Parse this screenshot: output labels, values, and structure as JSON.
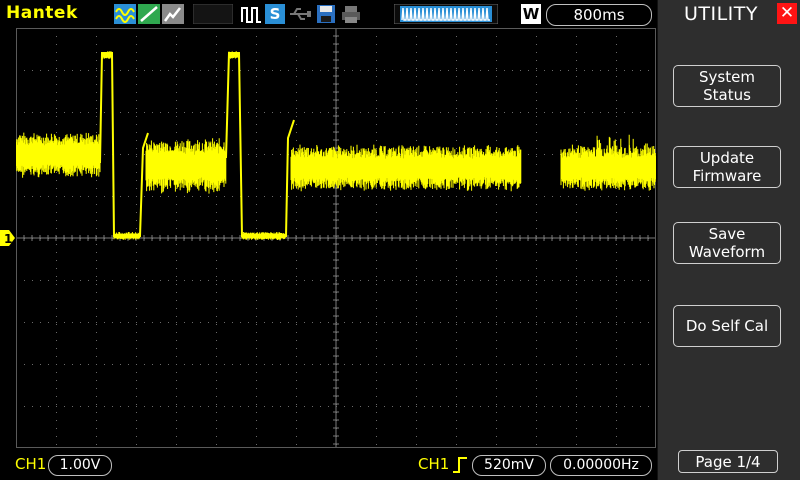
{
  "brand": "Hantek",
  "timebase": "800ms",
  "top_mode_letter": "S",
  "window_letter": "W",
  "menu": {
    "title": "UTILITY",
    "buttons": [
      {
        "label": "System\nStatus"
      },
      {
        "label": "Update\nFirmware"
      },
      {
        "label": "Save\nWaveform"
      },
      {
        "label": "Do Self Cal"
      }
    ],
    "page": "Page 1/4"
  },
  "channel": {
    "name": "CH1",
    "volts_div": "1.00V",
    "marker": "1"
  },
  "trigger": {
    "source": "CH1",
    "edge": "rising",
    "level": "520mV",
    "frequency": "0.00000Hz"
  },
  "colors": {
    "channel1": "#ffff00",
    "close": "#ff1414",
    "menu_bg": "#2e2e2e"
  },
  "icons": [
    "waveform-mode-icon",
    "run-stop-icon",
    "single-trigger-icon",
    "usb-icon",
    "save-icon",
    "print-icon",
    "memory-window-icon"
  ]
}
